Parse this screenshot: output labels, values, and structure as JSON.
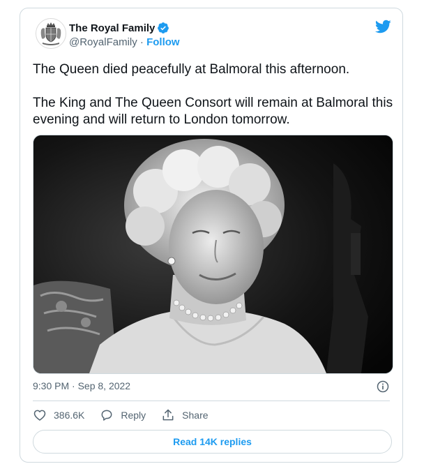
{
  "account": {
    "display_name": "The Royal Family",
    "handle": "@RoyalFamily",
    "separator": "·",
    "follow_label": "Follow"
  },
  "tweet": {
    "paragraphs": [
      "The Queen died peacefully at Balmoral this afternoon.",
      "The King and The Queen Consort will remain at Balmoral this evening and will return to London tomorrow."
    ],
    "timestamp": "9:30 PM · Sep 8, 2022"
  },
  "actions": {
    "likes": "386.6K",
    "reply_label": "Reply",
    "share_label": "Share"
  },
  "read_replies_label": "Read 14K replies",
  "colors": {
    "accent": "#1d9bf0",
    "text": "#0f1419",
    "muted": "#536471",
    "border": "#cfd9de"
  },
  "icons": [
    "royal-crest-icon",
    "verified-badge-icon",
    "twitter-bird-icon",
    "info-icon",
    "heart-icon",
    "reply-icon",
    "share-icon"
  ]
}
